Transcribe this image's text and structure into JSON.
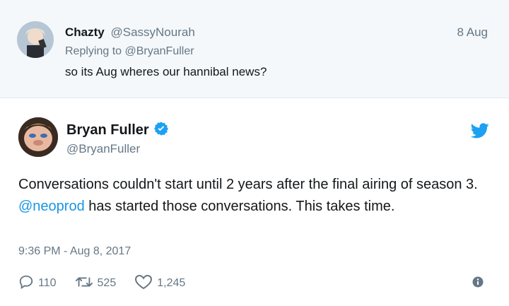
{
  "reply_tweet": {
    "name": "Chazty",
    "handle": "@SassyNourah",
    "date": "8 Aug",
    "replying_prefix": "Replying to",
    "replying_handle": "@BryanFuller",
    "text": "so its Aug wheres our hannibal news?"
  },
  "main_tweet": {
    "name": "Bryan Fuller",
    "handle": "@BryanFuller",
    "text_part1": "Conversations couldn't start until 2 years after the final airing of season 3.",
    "mention": "@neoprod",
    "text_part2": "has started those conversations. This takes time.",
    "timestamp": "9:36 PM - Aug 8, 2017"
  },
  "actions": {
    "replies": "110",
    "retweets": "525",
    "likes": "1,245"
  },
  "colors": {
    "twitter_blue": "#1da1f2",
    "link_blue": "#1b95e0",
    "muted": "#657786"
  },
  "icons": [
    "verified-badge-icon",
    "twitter-bird-icon",
    "reply-icon",
    "retweet-icon",
    "like-icon",
    "info-icon"
  ]
}
